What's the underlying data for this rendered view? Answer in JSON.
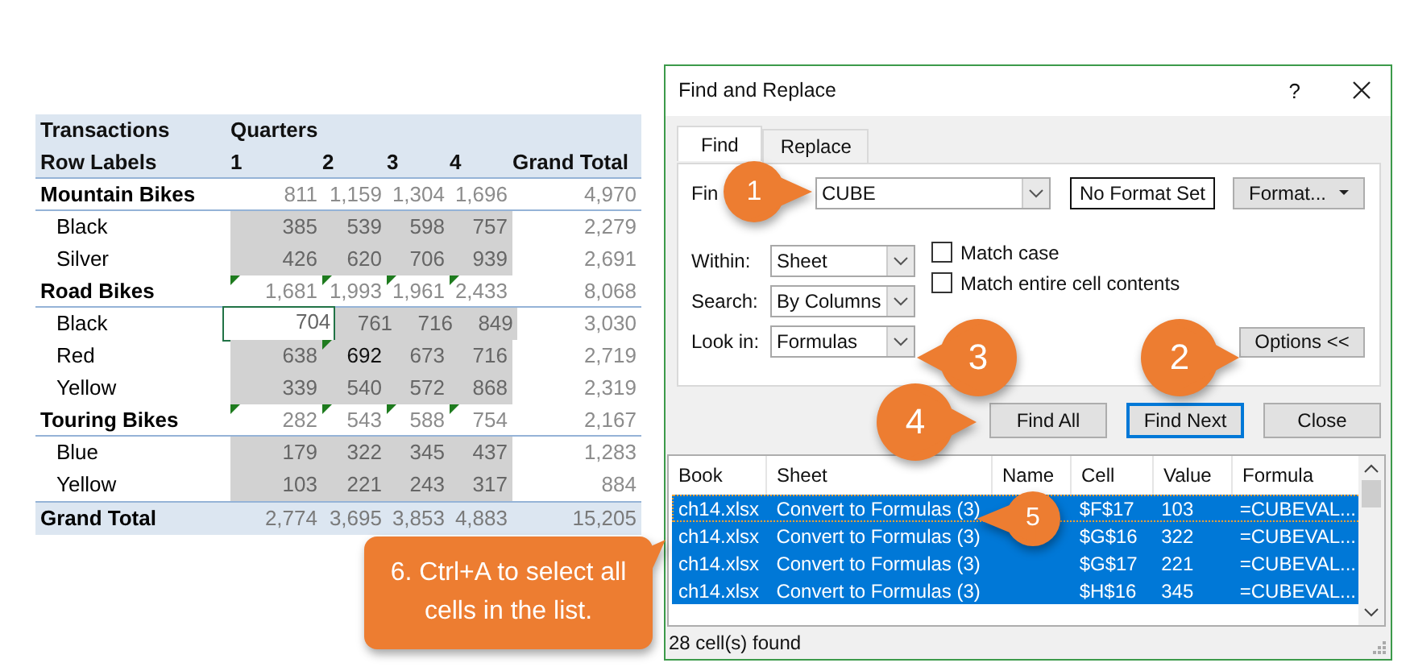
{
  "table": {
    "header_rows": [
      [
        "Transactions",
        "Quarters"
      ],
      [
        "Row Labels",
        "1",
        "2",
        "3",
        "4",
        "Grand Total"
      ]
    ],
    "rows": [
      {
        "kind": "group",
        "label": "Mountain Bikes",
        "cells": [
          {
            "text": "811",
            "selected": false,
            "flagged": false,
            "active": false,
            "dimmed": true
          },
          {
            "text": "1,159",
            "selected": false,
            "flagged": false,
            "active": false,
            "dimmed": true
          },
          {
            "text": "1,304",
            "selected": false,
            "flagged": false,
            "active": false,
            "dimmed": true
          },
          {
            "text": "1,696",
            "selected": false,
            "flagged": false,
            "active": false,
            "dimmed": true
          },
          {
            "text": "4,970",
            "selected": false,
            "flagged": false,
            "active": false,
            "dimmed": true
          }
        ]
      },
      {
        "kind": "item",
        "label": "Black",
        "cells": [
          {
            "text": "385",
            "selected": true,
            "flagged": false,
            "active": false,
            "dimmed": true
          },
          {
            "text": "539",
            "selected": true,
            "flagged": false,
            "active": false,
            "dimmed": true
          },
          {
            "text": "598",
            "selected": true,
            "flagged": false,
            "active": false,
            "dimmed": true
          },
          {
            "text": "757",
            "selected": true,
            "flagged": false,
            "active": false,
            "dimmed": true
          },
          {
            "text": "2,279",
            "selected": false,
            "flagged": false,
            "active": false,
            "dimmed": true
          }
        ]
      },
      {
        "kind": "item",
        "label": "Silver",
        "cells": [
          {
            "text": "426",
            "selected": true,
            "flagged": false,
            "active": false,
            "dimmed": true
          },
          {
            "text": "620",
            "selected": true,
            "flagged": false,
            "active": false,
            "dimmed": true
          },
          {
            "text": "706",
            "selected": true,
            "flagged": false,
            "active": false,
            "dimmed": true
          },
          {
            "text": "939",
            "selected": true,
            "flagged": false,
            "active": false,
            "dimmed": true
          },
          {
            "text": "2,691",
            "selected": false,
            "flagged": false,
            "active": false,
            "dimmed": true
          }
        ]
      },
      {
        "kind": "group",
        "label": "Road Bikes",
        "cells": [
          {
            "text": "1,681",
            "selected": false,
            "flagged": true,
            "active": false,
            "dimmed": true
          },
          {
            "text": "1,993",
            "selected": false,
            "flagged": true,
            "active": false,
            "dimmed": true
          },
          {
            "text": "1,961",
            "selected": false,
            "flagged": true,
            "active": false,
            "dimmed": true
          },
          {
            "text": "2,433",
            "selected": false,
            "flagged": true,
            "active": false,
            "dimmed": true
          },
          {
            "text": "8,068",
            "selected": false,
            "flagged": false,
            "active": false,
            "dimmed": true
          }
        ]
      },
      {
        "kind": "item",
        "label": "Black",
        "cells": [
          {
            "text": "704",
            "selected": true,
            "flagged": false,
            "active": true,
            "dimmed": true
          },
          {
            "text": "761",
            "selected": true,
            "flagged": false,
            "active": false,
            "dimmed": true
          },
          {
            "text": "716",
            "selected": true,
            "flagged": false,
            "active": false,
            "dimmed": true
          },
          {
            "text": "849",
            "selected": true,
            "flagged": false,
            "active": false,
            "dimmed": true
          },
          {
            "text": "3,030",
            "selected": false,
            "flagged": false,
            "active": false,
            "dimmed": true
          }
        ]
      },
      {
        "kind": "item",
        "label": "Red",
        "cells": [
          {
            "text": "638",
            "selected": true,
            "flagged": false,
            "active": false,
            "dimmed": true
          },
          {
            "text": "692",
            "selected": true,
            "flagged": true,
            "active": false,
            "dimmed": false
          },
          {
            "text": "673",
            "selected": true,
            "flagged": false,
            "active": false,
            "dimmed": true
          },
          {
            "text": "716",
            "selected": true,
            "flagged": false,
            "active": false,
            "dimmed": true
          },
          {
            "text": "2,719",
            "selected": false,
            "flagged": false,
            "active": false,
            "dimmed": true
          }
        ]
      },
      {
        "kind": "item",
        "label": "Yellow",
        "cells": [
          {
            "text": "339",
            "selected": true,
            "flagged": false,
            "active": false,
            "dimmed": true
          },
          {
            "text": "540",
            "selected": true,
            "flagged": false,
            "active": false,
            "dimmed": true
          },
          {
            "text": "572",
            "selected": true,
            "flagged": false,
            "active": false,
            "dimmed": true
          },
          {
            "text": "868",
            "selected": true,
            "flagged": false,
            "active": false,
            "dimmed": true
          },
          {
            "text": "2,319",
            "selected": false,
            "flagged": false,
            "active": false,
            "dimmed": true
          }
        ]
      },
      {
        "kind": "group",
        "label": "Touring Bikes",
        "cells": [
          {
            "text": "282",
            "selected": false,
            "flagged": true,
            "active": false,
            "dimmed": true
          },
          {
            "text": "543",
            "selected": false,
            "flagged": true,
            "active": false,
            "dimmed": true
          },
          {
            "text": "588",
            "selected": false,
            "flagged": true,
            "active": false,
            "dimmed": true
          },
          {
            "text": "754",
            "selected": false,
            "flagged": true,
            "active": false,
            "dimmed": true
          },
          {
            "text": "2,167",
            "selected": false,
            "flagged": false,
            "active": false,
            "dimmed": true
          }
        ]
      },
      {
        "kind": "item",
        "label": "Blue",
        "cells": [
          {
            "text": "179",
            "selected": true,
            "flagged": false,
            "active": false,
            "dimmed": true
          },
          {
            "text": "322",
            "selected": true,
            "flagged": false,
            "active": false,
            "dimmed": true
          },
          {
            "text": "345",
            "selected": true,
            "flagged": false,
            "active": false,
            "dimmed": true
          },
          {
            "text": "437",
            "selected": true,
            "flagged": false,
            "active": false,
            "dimmed": true
          },
          {
            "text": "1,283",
            "selected": false,
            "flagged": false,
            "active": false,
            "dimmed": true
          }
        ]
      },
      {
        "kind": "item",
        "label": "Yellow",
        "cells": [
          {
            "text": "103",
            "selected": true,
            "flagged": false,
            "active": false,
            "dimmed": true
          },
          {
            "text": "221",
            "selected": true,
            "flagged": false,
            "active": false,
            "dimmed": true
          },
          {
            "text": "243",
            "selected": true,
            "flagged": false,
            "active": false,
            "dimmed": true
          },
          {
            "text": "317",
            "selected": true,
            "flagged": false,
            "active": false,
            "dimmed": true
          },
          {
            "text": "884",
            "selected": false,
            "flagged": false,
            "active": false,
            "dimmed": true
          }
        ]
      },
      {
        "kind": "total",
        "label": "Grand Total",
        "cells": [
          {
            "text": "2,774",
            "selected": false,
            "flagged": false,
            "active": false,
            "dimmed": true
          },
          {
            "text": "3,695",
            "selected": false,
            "flagged": false,
            "active": false,
            "dimmed": true
          },
          {
            "text": "3,853",
            "selected": false,
            "flagged": false,
            "active": false,
            "dimmed": true
          },
          {
            "text": "4,883",
            "selected": false,
            "flagged": false,
            "active": false,
            "dimmed": true
          },
          {
            "text": "15,205",
            "selected": false,
            "flagged": false,
            "active": false,
            "dimmed": true
          }
        ]
      }
    ]
  },
  "dialog": {
    "title": "Find and Replace",
    "help": "?",
    "tabs": [
      {
        "label": "Find",
        "selected": true
      },
      {
        "label": "Replace",
        "selected": false
      }
    ],
    "find_field": {
      "label": "Fin",
      "value": "CUBE"
    },
    "format_status": "No Format Set",
    "format_button": "Format...",
    "dropdowns": [
      {
        "label": "Within:",
        "value": "Sheet"
      },
      {
        "label": "Search:",
        "value": "By Columns"
      },
      {
        "label": "Look in:",
        "value": "Formulas"
      }
    ],
    "checkboxes": [
      {
        "label": "Match case",
        "checked": false
      },
      {
        "label": "Match entire cell contents",
        "checked": false
      }
    ],
    "options_button": "Options <<",
    "buttons": [
      {
        "label": "Find All",
        "default": false
      },
      {
        "label": "Find Next",
        "default": true
      },
      {
        "label": "Close",
        "default": false
      }
    ],
    "results": {
      "columns": [
        "Book",
        "Sheet",
        "Name",
        "Cell",
        "Value",
        "Formula"
      ],
      "rows": [
        {
          "book": "ch14.xlsx",
          "sheet": "Convert to Formulas (3)",
          "cell": "$F$17",
          "value": "103",
          "formula": "=CUBEVAL...",
          "selected": true,
          "focused": true
        },
        {
          "book": "ch14.xlsx",
          "sheet": "Convert to Formulas (3)",
          "cell": "$G$16",
          "value": "322",
          "formula": "=CUBEVAL...",
          "selected": true,
          "focused": false
        },
        {
          "book": "ch14.xlsx",
          "sheet": "Convert to Formulas (3)",
          "cell": "$G$17",
          "value": "221",
          "formula": "=CUBEVAL...",
          "selected": true,
          "focused": false
        },
        {
          "book": "ch14.xlsx",
          "sheet": "Convert to Formulas (3)",
          "cell": "$H$16",
          "value": "345",
          "formula": "=CUBEVAL...",
          "selected": true,
          "focused": false
        }
      ]
    },
    "status": "28 cell(s) found"
  },
  "callouts": [
    {
      "kind": "pin",
      "text": "1"
    },
    {
      "kind": "pin",
      "text": "2"
    },
    {
      "kind": "pin",
      "text": "3"
    },
    {
      "kind": "pin",
      "text": "4"
    },
    {
      "kind": "pin",
      "text": "5"
    },
    {
      "kind": "box",
      "text": "6. Ctrl+A to select all cells in the list."
    }
  ]
}
